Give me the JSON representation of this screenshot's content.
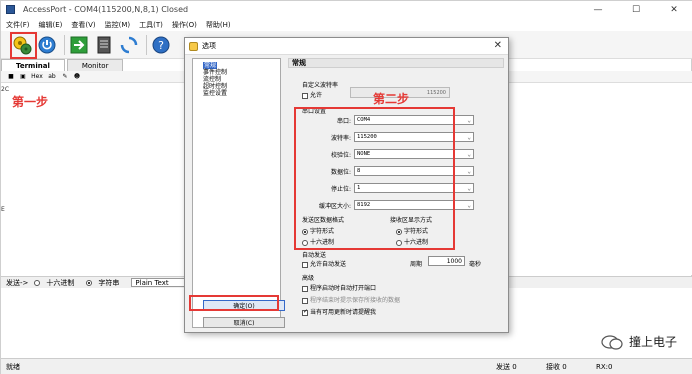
{
  "app": {
    "title": "AccessPort - COM4(115200,N,8,1) Closed",
    "win_minimize": "—",
    "win_maximize": "☐",
    "win_close": "✕"
  },
  "menu": [
    "文件(F)",
    "编辑(E)",
    "查看(V)",
    "监控(M)",
    "工具(T)",
    "操作(O)",
    "帮助(H)"
  ],
  "tabs": [
    "Terminal",
    "Monitor"
  ],
  "subtoolbar": {
    "hex": "Hex",
    "ab": "ab"
  },
  "annotations": {
    "step1": "第一步",
    "step2": "第二步"
  },
  "side_labels": {
    "a": "2C",
    "b": "E"
  },
  "send_bar": {
    "label": "发送->",
    "hex_label": "十六进制",
    "string_label": "字符串",
    "mode_value": "Plain Text"
  },
  "status": {
    "ready": "就绪",
    "sent": "发送 0",
    "recv": "接收 0",
    "rx": "RX:0"
  },
  "dialog": {
    "title": "选项",
    "close": "✕",
    "tree": [
      "常规",
      "事件控制",
      "流控制",
      "超时控制",
      "监控设置"
    ],
    "ok_button": "确定(O)",
    "cancel_button": "取消(C)",
    "panel_title": "常规",
    "custom_baud": {
      "group": "自定义波特率",
      "allow": "允许",
      "value": "115200"
    },
    "serial": {
      "group": "串口设置",
      "fields": [
        {
          "label": "串口:",
          "value": "COM4"
        },
        {
          "label": "波特率:",
          "value": "115200"
        },
        {
          "label": "校验位:",
          "value": "NONE"
        },
        {
          "label": "数据位:",
          "value": "8"
        },
        {
          "label": "停止位:",
          "value": "1"
        },
        {
          "label": "缓冲区大小:",
          "value": "8192"
        }
      ]
    },
    "send_format": {
      "group": "发送区数据格式",
      "opt1": "字符形式",
      "opt2": "十六进制"
    },
    "recv_format": {
      "group": "接收区显示方式",
      "opt1": "字符形式",
      "opt2": "十六进制"
    },
    "auto_send": {
      "group": "自动发送",
      "allow": "允许自动发送",
      "period_label": "周期",
      "period_value": "1000",
      "unit": "毫秒"
    },
    "advanced": {
      "group": "高级",
      "opt1": "程序启动时自动打开端口",
      "opt2": "程序结束时提示保存所接收的数据",
      "opt3": "当有可用更新时请提醒我"
    }
  },
  "watermark": "撞上电子",
  "colors": {
    "highlight_red": "#e53935",
    "selection_blue": "#3568c8"
  }
}
